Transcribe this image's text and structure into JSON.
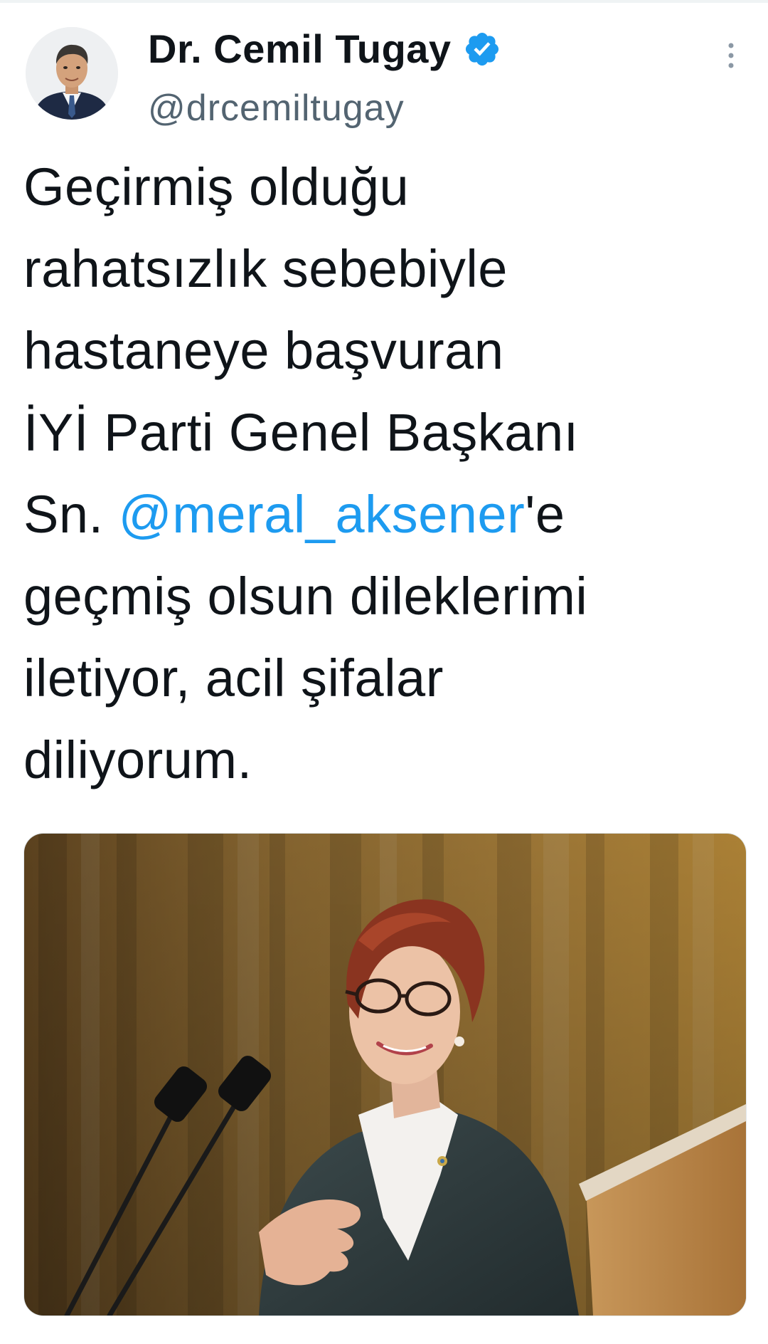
{
  "tweet": {
    "author": {
      "display_name": "Dr. Cemil Tugay",
      "handle": "@drcemiltugay",
      "verified": true
    },
    "text_lines": [
      {
        "before": "Geçirmiş olduğu",
        "mention": "",
        "after": ""
      },
      {
        "before": "rahatsızlık sebebiyle",
        "mention": "",
        "after": ""
      },
      {
        "before": "hastaneye başvuran",
        "mention": "",
        "after": ""
      },
      {
        "before": "İYİ Parti Genel Başkanı",
        "mention": "",
        "after": ""
      },
      {
        "before": "Sn. ",
        "mention": "@meral_aksener",
        "after": "'e"
      },
      {
        "before": "geçmiş olsun dileklerimi",
        "mention": "",
        "after": ""
      },
      {
        "before": "iletiyor, acil şifalar",
        "mention": "",
        "after": ""
      },
      {
        "before": "diliyorum.",
        "mention": "",
        "after": ""
      }
    ],
    "colors": {
      "mention": "#1d9bf0",
      "verified_badge": "#1d9bf0",
      "handle": "#536471",
      "text": "#0f1419"
    },
    "icons": {
      "verified": "verified-badge-icon",
      "more": "more-vertical-icon"
    }
  }
}
